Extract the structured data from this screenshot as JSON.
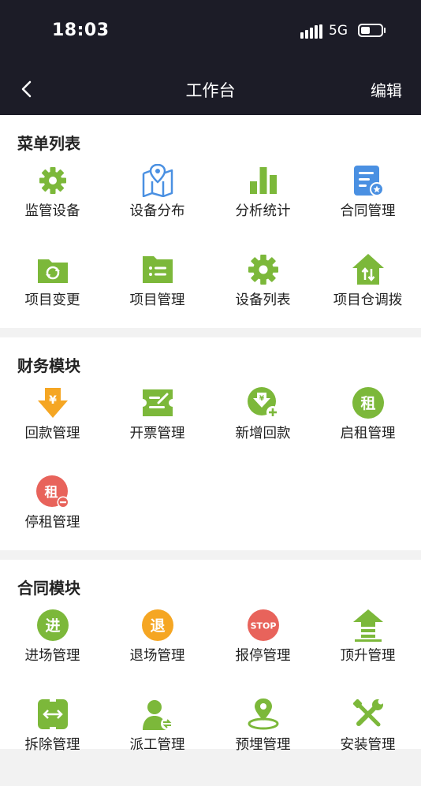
{
  "status_bar": {
    "time": "18:03",
    "network": "5G"
  },
  "nav": {
    "title": "工作台",
    "edit_label": "编辑"
  },
  "sections": [
    {
      "title": "菜单列表",
      "items": [
        {
          "label": "监管设备",
          "icon": "gear-icon"
        },
        {
          "label": "设备分布",
          "icon": "map-pin-icon"
        },
        {
          "label": "分析统计",
          "icon": "bar-chart-icon"
        },
        {
          "label": "合同管理",
          "icon": "contract-document-icon"
        },
        {
          "label": "项目变更",
          "icon": "folder-sync-icon"
        },
        {
          "label": "项目管理",
          "icon": "folder-list-icon"
        },
        {
          "label": "设备列表",
          "icon": "gear-icon"
        },
        {
          "label": "项目仓调拨",
          "icon": "warehouse-transfer-icon"
        }
      ]
    },
    {
      "title": "财务模块",
      "items": [
        {
          "label": "回款管理",
          "icon": "yuan-down-arrow-icon",
          "glyph": "¥"
        },
        {
          "label": "开票管理",
          "icon": "invoice-ticket-icon"
        },
        {
          "label": "新增回款",
          "icon": "add-payment-icon",
          "glyph": "¥"
        },
        {
          "label": "启租管理",
          "icon": "start-rent-icon",
          "glyph": "租"
        },
        {
          "label": "停租管理",
          "icon": "stop-rent-icon",
          "glyph": "租"
        }
      ]
    },
    {
      "title": "合同模块",
      "items": [
        {
          "label": "进场管理",
          "icon": "enter-site-icon",
          "glyph": "进"
        },
        {
          "label": "退场管理",
          "icon": "exit-site-icon",
          "glyph": "退"
        },
        {
          "label": "报停管理",
          "icon": "stop-sign-icon",
          "glyph": "STOP"
        },
        {
          "label": "顶升管理",
          "icon": "jack-up-icon"
        },
        {
          "label": "拆除管理",
          "icon": "dismantle-icon"
        },
        {
          "label": "派工管理",
          "icon": "dispatch-worker-icon"
        },
        {
          "label": "预埋管理",
          "icon": "embed-location-icon"
        },
        {
          "label": "安装管理",
          "icon": "install-tools-icon"
        }
      ]
    }
  ],
  "colors": {
    "green": "#7cb83a",
    "blue": "#4a90e2",
    "orange": "#f5a623",
    "red": "#e8635b",
    "header": "#1c1c27"
  }
}
